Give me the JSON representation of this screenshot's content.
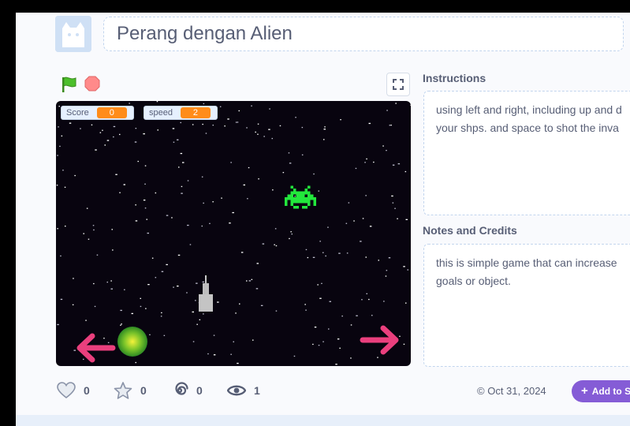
{
  "project": {
    "title": "Perang dengan Alien"
  },
  "stage": {
    "monitors": [
      {
        "label": "Score",
        "value": "0"
      },
      {
        "label": "speed",
        "value": "2"
      }
    ]
  },
  "instructions": {
    "heading": "Instructions",
    "lines": [
      "using left and right, including up and d",
      "your shps. and space to shot the inva"
    ]
  },
  "notes": {
    "heading": "Notes and Credits",
    "lines": [
      "this is simple game that can increase",
      "goals or object."
    ]
  },
  "stats": {
    "loves": "0",
    "favorites": "0",
    "remixes": "0",
    "views": "1"
  },
  "shared_date": "Oct 31, 2024",
  "add_to_studio_label": "Add to S",
  "colors": {
    "accent_purple": "#855cd6",
    "monitor_orange": "#ff8c1a",
    "alien_green": "#22e83c",
    "arrow_pink": "#ea3f7d"
  }
}
